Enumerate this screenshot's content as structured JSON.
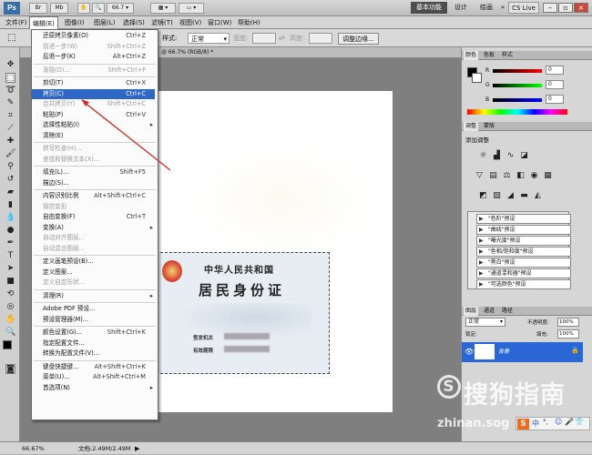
{
  "app": {
    "logo": "Ps",
    "zoom": "66.7",
    "workspace": {
      "items": [
        "基本功能",
        "设计",
        "绘画"
      ],
      "more": "»",
      "cs_live": "CS Live"
    }
  },
  "menubar": [
    "文件(F)",
    "编辑(E)",
    "图像(I)",
    "图层(L)",
    "选择(S)",
    "滤镜(T)",
    "视图(V)",
    "窗口(W)",
    "帮助(H)"
  ],
  "options": {
    "style_label": "样式:",
    "style_value": "正常",
    "width_label": "宽度:",
    "height_label": "高度:",
    "refine_edge": "调整边缘..."
  },
  "document": {
    "tab_title": "@ 66.7% (RGB/8) *",
    "id_card": {
      "title": "中华人民共和国",
      "subtitle": "居民身份证",
      "field_1": "签发机关",
      "field_2": "有效期限"
    }
  },
  "edit_menu": [
    {
      "label": "还原拷贝像素(O)",
      "shortcut": "Ctrl+Z",
      "state": "normal"
    },
    {
      "label": "前进一步(W)",
      "shortcut": "Shift+Ctrl+Z",
      "state": "disabled"
    },
    {
      "label": "后退一步(K)",
      "shortcut": "Alt+Ctrl+Z",
      "state": "normal"
    },
    {
      "sep": true
    },
    {
      "label": "渐隐(D)...",
      "shortcut": "Shift+Ctrl+F",
      "state": "disabled"
    },
    {
      "sep": true
    },
    {
      "label": "剪切(T)",
      "shortcut": "Ctrl+X",
      "state": "normal"
    },
    {
      "label": "拷贝(C)",
      "shortcut": "Ctrl+C",
      "state": "highlighted"
    },
    {
      "label": "合并拷贝(Y)",
      "shortcut": "Shift+Ctrl+C",
      "state": "disabled"
    },
    {
      "label": "粘贴(P)",
      "shortcut": "Ctrl+V",
      "state": "normal"
    },
    {
      "label": "选择性粘贴(I)",
      "submenu": true,
      "state": "normal"
    },
    {
      "label": "清除(E)",
      "state": "normal"
    },
    {
      "sep": true
    },
    {
      "label": "拼写检查(H)...",
      "state": "disabled"
    },
    {
      "label": "查找和替换文本(X)...",
      "state": "disabled"
    },
    {
      "sep": true
    },
    {
      "label": "填充(L)...",
      "shortcut": "Shift+F5",
      "state": "normal"
    },
    {
      "label": "描边(S)...",
      "state": "normal"
    },
    {
      "sep": true
    },
    {
      "label": "内容识别比例",
      "shortcut": "Alt+Shift+Ctrl+C",
      "state": "normal"
    },
    {
      "label": "操控变形",
      "state": "disabled"
    },
    {
      "label": "自由变换(F)",
      "shortcut": "Ctrl+T",
      "state": "normal"
    },
    {
      "label": "变换(A)",
      "submenu": true,
      "state": "normal"
    },
    {
      "label": "自动对齐图层...",
      "state": "disabled"
    },
    {
      "label": "自动混合图层...",
      "state": "disabled"
    },
    {
      "sep": true
    },
    {
      "label": "定义画笔预设(B)...",
      "state": "normal"
    },
    {
      "label": "定义图案...",
      "state": "normal"
    },
    {
      "label": "定义自定形状...",
      "state": "disabled"
    },
    {
      "sep": true
    },
    {
      "label": "清理(R)",
      "submenu": true,
      "state": "normal"
    },
    {
      "sep": true
    },
    {
      "label": "Adobe PDF 预设...",
      "state": "normal"
    },
    {
      "label": "预设管理器(M)...",
      "state": "normal"
    },
    {
      "sep": true
    },
    {
      "label": "颜色设置(G)...",
      "shortcut": "Shift+Ctrl+K",
      "state": "normal"
    },
    {
      "label": "指定配置文件...",
      "state": "normal"
    },
    {
      "label": "转换为配置文件(V)...",
      "state": "normal"
    },
    {
      "sep": true
    },
    {
      "label": "键盘快捷键...",
      "shortcut": "Alt+Shift+Ctrl+K",
      "state": "normal"
    },
    {
      "label": "菜单(U)...",
      "shortcut": "Alt+Shift+Ctrl+M",
      "state": "normal"
    },
    {
      "label": "首选项(N)",
      "submenu": true,
      "state": "normal"
    }
  ],
  "color_panel": {
    "tabs": [
      "颜色",
      "色板",
      "样式"
    ],
    "channels": [
      {
        "name": "R",
        "value": "0"
      },
      {
        "name": "G",
        "value": "0"
      },
      {
        "name": "B",
        "value": "0"
      }
    ]
  },
  "adjustments_panel": {
    "tabs": [
      "调整",
      "蒙版"
    ],
    "title": "添加调整",
    "presets": [
      "\"色阶\"预设",
      "\"曲线\"预设",
      "\"曝光度\"预设",
      "\"色相/饱和度\"预设",
      "\"黑白\"预设",
      "\"通道混和器\"预设",
      "\"可选颜色\"预设"
    ]
  },
  "layers_panel": {
    "tabs": [
      "图层",
      "通道",
      "路径"
    ],
    "blend_mode": "正常",
    "opacity_label": "不透明度:",
    "opacity_value": "100%",
    "lock_label": "锁定:",
    "fill_label": "填充:",
    "fill_value": "100%",
    "layer_name": "背景"
  },
  "statusbar": {
    "zoom": "66.67%",
    "doc_info": "文档:2.49M/2.49M"
  },
  "watermark": {
    "brand": "搜狗指南",
    "url": "zhinan.sog"
  },
  "ime_bar": {
    "items": [
      "中",
      "°,"
    ]
  },
  "colors": {
    "highlight": "#2f68c4",
    "arrow": "#d0322b",
    "layer_selected": "#2a66d6"
  }
}
